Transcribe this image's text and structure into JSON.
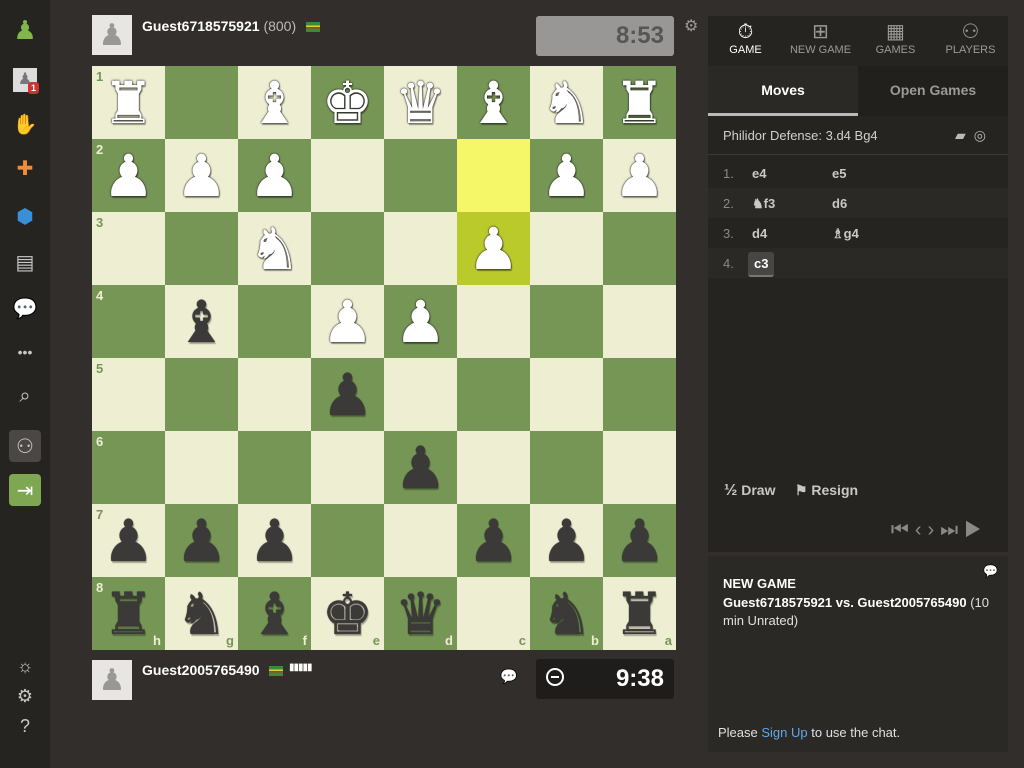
{
  "nav": {
    "icons": [
      "pawn-logo-icon",
      "profile-icon",
      "puzzle-icon",
      "lesson-icon",
      "learn-icon",
      "news-icon",
      "chat-icon",
      "more-icon",
      "search-icon",
      "add-friend-icon",
      "login-icon",
      "theme-icon",
      "settings-icon",
      "help-icon"
    ],
    "profile_badge": "1",
    "more": "•••"
  },
  "top_player": {
    "name": "Guest6718575921",
    "rating": "(800)",
    "clock": "8:53"
  },
  "bottom_player": {
    "name": "Guest2005765490",
    "clock": "9:38"
  },
  "board": {
    "ranks": [
      "1",
      "2",
      "3",
      "4",
      "5",
      "6",
      "7",
      "8"
    ],
    "files": [
      "h",
      "g",
      "f",
      "e",
      "d",
      "c",
      "b",
      "a"
    ],
    "rows": [
      [
        "wR",
        "",
        "wB",
        "wK",
        "wQ",
        "wB",
        "wN",
        "wR"
      ],
      [
        "wP",
        "wP",
        "wP",
        "",
        "",
        "",
        "wP",
        "wP"
      ],
      [
        "",
        "",
        "wN",
        "",
        "",
        "wP",
        "",
        ""
      ],
      [
        "",
        "bB",
        "",
        "wP",
        "wP",
        "",
        "",
        ""
      ],
      [
        "",
        "",
        "",
        "bP",
        "",
        "",
        "",
        ""
      ],
      [
        "",
        "",
        "",
        "",
        "bP",
        "",
        "",
        ""
      ],
      [
        "bP",
        "bP",
        "bP",
        "",
        "",
        "bP",
        "bP",
        "bP"
      ],
      [
        "bR",
        "bN",
        "bB",
        "bK",
        "bQ",
        "",
        "bN",
        "bR"
      ]
    ],
    "highlights": [
      [
        1,
        5
      ],
      [
        2,
        5
      ]
    ],
    "colors": {
      "light": "#eeeed2",
      "dark": "#769656",
      "hl_light": "#f6f669",
      "hl_dark": "#baca2b"
    }
  },
  "panel": {
    "tabs": [
      {
        "label": "GAME",
        "icon": "stopwatch-icon"
      },
      {
        "label": "NEW GAME",
        "icon": "plus-icon"
      },
      {
        "label": "GAMES",
        "icon": "board-icon"
      },
      {
        "label": "PLAYERS",
        "icon": "players-icon"
      }
    ],
    "subtabs": [
      "Moves",
      "Open Games"
    ],
    "opening": "Philidor Defense: 3.d4 Bg4",
    "moves": [
      {
        "num": "1.",
        "white": "e4",
        "black": "e5"
      },
      {
        "num": "2.",
        "white": "♞f3",
        "black": "d6"
      },
      {
        "num": "3.",
        "white": "d4",
        "black": "♗g4"
      },
      {
        "num": "4.",
        "white": "c3",
        "black": ""
      }
    ],
    "draw_label": "Draw",
    "draw_icon": "½",
    "resign_label": "Resign",
    "controls": "⏮ ‹ › ⏭ ▶"
  },
  "chat": {
    "title": "NEW GAME",
    "players": "Guest6718575921 vs. Guest2005765490",
    "mode": "(10 min Unrated)",
    "footer_pre": "Please ",
    "footer_link": "Sign Up",
    "footer_post": " to use the chat."
  }
}
